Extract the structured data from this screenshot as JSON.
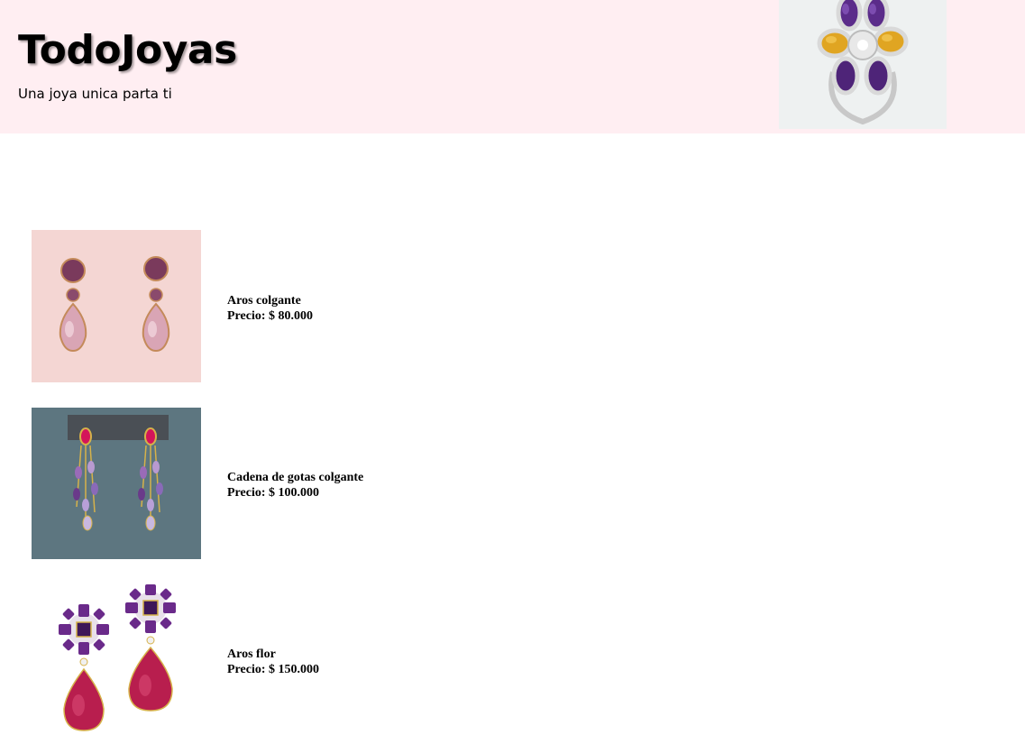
{
  "header": {
    "title": "TodoJoyas",
    "tagline": "Una joya unica parta ti",
    "image_icon": "flower-ring-image"
  },
  "products": [
    {
      "name": "Aros colgante",
      "price_label": "Precio: $ 80.000",
      "image_icon": "drop-earrings-image"
    },
    {
      "name": "Cadena de gotas colgante",
      "price_label": "Precio: $ 100.000",
      "image_icon": "chain-drop-earrings-image"
    },
    {
      "name": "Aros flor",
      "price_label": "Precio: $ 150.000",
      "image_icon": "flower-earrings-image"
    }
  ],
  "colors": {
    "header_background": "#ffeef2",
    "page_background": "#ffffff"
  }
}
